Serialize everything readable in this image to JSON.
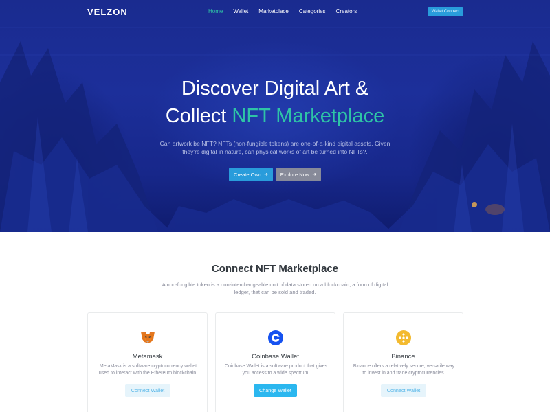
{
  "nav": {
    "logo": "VELZON",
    "links": [
      "Home",
      "Wallet",
      "Marketplace",
      "Categories",
      "Creators"
    ],
    "active_link": "Home",
    "wallet_button": "Wallet Connect"
  },
  "hero": {
    "title_line1": "Discover Digital Art &",
    "title_line2_plain": "Collect ",
    "title_line2_accent": "NFT Marketplace",
    "subtitle": "Can artwork be NFT? NFTs (non-fungible tokens) are one-of-a-kind digital assets. Given they're digital in nature, can physical works of art be turned into NFTs?.",
    "primary_button": "Create Own",
    "secondary_button": "Explore Now",
    "arrow_icon": "arrow-right-icon"
  },
  "section": {
    "title": "Connect NFT Marketplace",
    "subtitle": "A non-fungible token is a non-interchangeable unit of data stored on a blockchain, a form of digital ledger, that can be sold and traded."
  },
  "wallets": [
    {
      "name": "Metamask",
      "icon": "metamask-icon",
      "description": "MetaMask is a software cryptocurrency wallet used to interact with the Ethereum blockchain.",
      "button": "Connect Wallet"
    },
    {
      "name": "Coinbase Wallet",
      "icon": "coinbase-icon",
      "description": "Coinbase Wallet is a software product that gives you access to a wide spectrum.",
      "button": "Change Wallet"
    },
    {
      "name": "Binance",
      "icon": "binance-icon",
      "description": "Binance offers a relatively secure, versatile way to invest in and trade cryptocurrencies.",
      "button": "Connect Wallet"
    }
  ],
  "colors": {
    "accent_green": "#2ec4a6",
    "primary_blue": "#299cdb",
    "secondary_gray": "#878a99",
    "hero_bg": "#1c2f9a"
  }
}
